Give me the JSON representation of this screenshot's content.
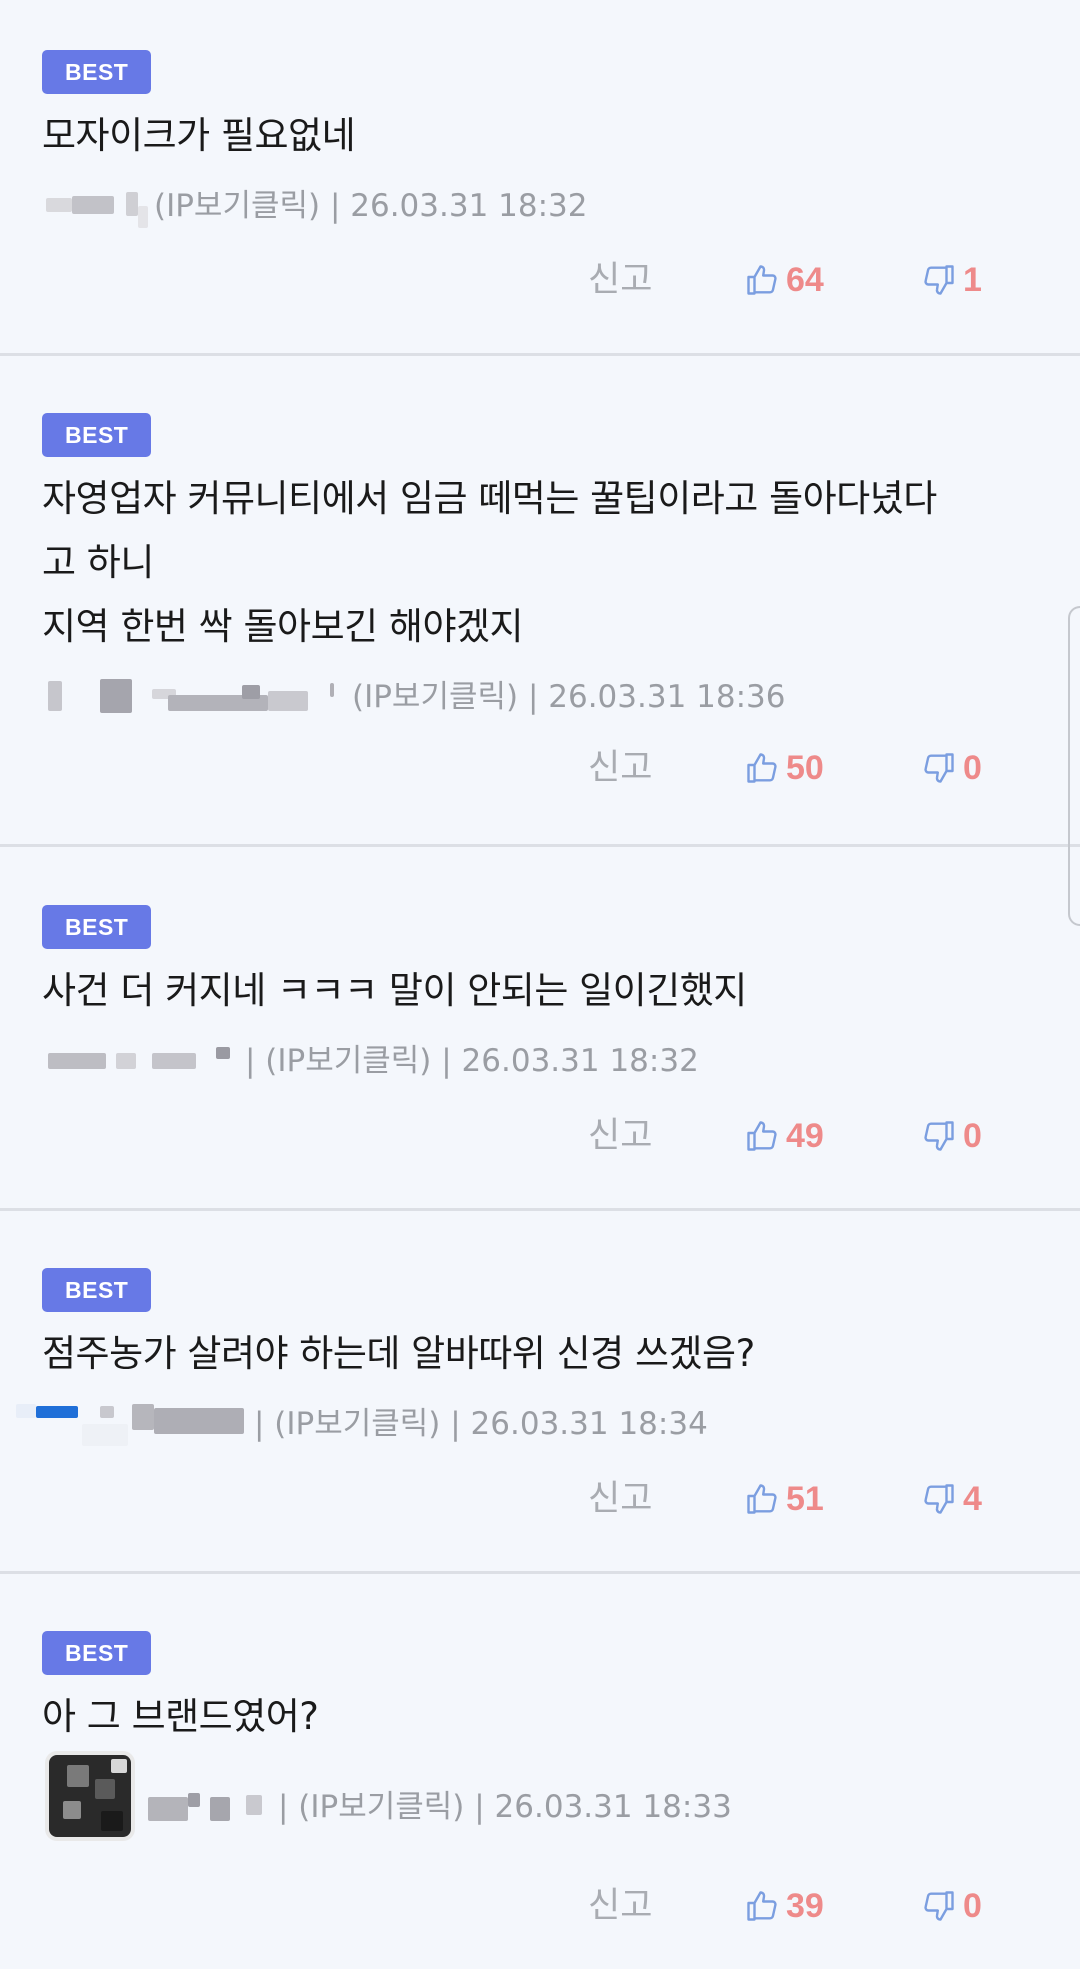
{
  "comments": [
    {
      "badge": "BEST",
      "lines": [
        "모자이크가 필요없네"
      ],
      "meta": "(IP보기클릭) | 26.03.31 18:32",
      "report": "신고",
      "likes": "64",
      "dislikes": "1"
    },
    {
      "badge": "BEST",
      "lines": [
        "자영업자 커뮤니티에서 임금 떼먹는 꿀팁이라고 돌아다녔다",
        "고 하니",
        "지역 한번 싹 돌아보긴 해야겠지"
      ],
      "meta": "(IP보기클릭) | 26.03.31 18:36",
      "report": "신고",
      "likes": "50",
      "dislikes": "0"
    },
    {
      "badge": "BEST",
      "lines": [
        "사건 더 커지네 ㅋㅋㅋ 말이 안되는 일이긴했지"
      ],
      "meta": "| (IP보기클릭) | 26.03.31 18:32",
      "report": "신고",
      "likes": "49",
      "dislikes": "0"
    },
    {
      "badge": "BEST",
      "lines": [
        "점주농가 살려야 하는데 알바따위 신경 쓰겠음?"
      ],
      "meta": "| (IP보기클릭) | 26.03.31 18:34",
      "report": "신고",
      "likes": "51",
      "dislikes": "4"
    },
    {
      "badge": "BEST",
      "lines": [
        "아 그 브랜드였어?"
      ],
      "meta": "| (IP보기클릭) | 26.03.31 18:33",
      "report": "신고",
      "likes": "39",
      "dislikes": "0"
    }
  ],
  "icons": {
    "like": "thumbs-up-icon",
    "dislike": "thumbs-down-icon"
  },
  "colors": {
    "badge": "#6779e6",
    "count": "#ee8a8a",
    "thumb": "#7b9ee0",
    "background": "#f4f7fc"
  }
}
